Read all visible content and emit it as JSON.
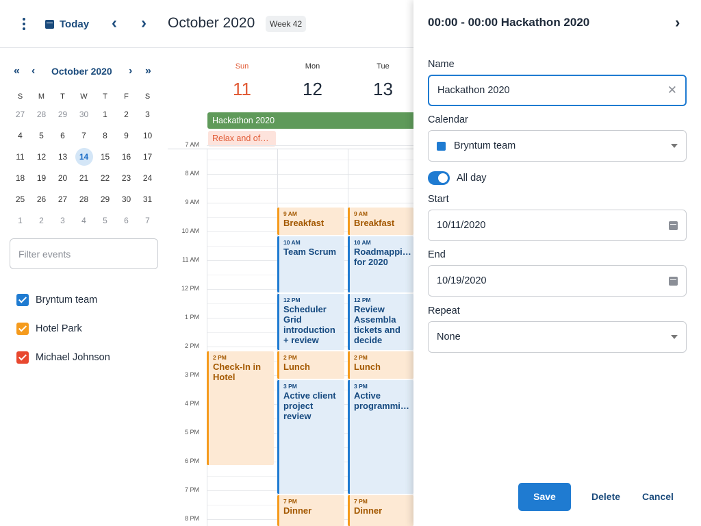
{
  "toolbar": {
    "today_label": "Today",
    "prev": "‹",
    "next": "›",
    "month_title": "October 2020",
    "week_badge": "Week 42"
  },
  "mini_calendar": {
    "title": "October 2020",
    "prev_year": "«",
    "prev_month": "‹",
    "next_month": "›",
    "next_year": "»",
    "weekdays": [
      "S",
      "M",
      "T",
      "W",
      "T",
      "F",
      "S"
    ],
    "weeks": [
      [
        "27",
        "28",
        "29",
        "30",
        "1",
        "2",
        "3"
      ],
      [
        "4",
        "5",
        "6",
        "7",
        "8",
        "9",
        "10"
      ],
      [
        "11",
        "12",
        "13",
        "14",
        "15",
        "16",
        "17"
      ],
      [
        "18",
        "19",
        "20",
        "21",
        "22",
        "23",
        "24"
      ],
      [
        "25",
        "26",
        "27",
        "28",
        "29",
        "30",
        "31"
      ],
      [
        "1",
        "2",
        "3",
        "4",
        "5",
        "6",
        "7"
      ]
    ],
    "today": "14"
  },
  "filter": {
    "placeholder": "Filter events"
  },
  "calendars": [
    {
      "label": "Bryntum team",
      "color": "#1f7bd1"
    },
    {
      "label": "Hotel Park",
      "color": "#f59b1d"
    },
    {
      "label": "Michael Johnson",
      "color": "#e8482f"
    }
  ],
  "week_view": {
    "days": [
      {
        "name": "Sun",
        "date": "11"
      },
      {
        "name": "Mon",
        "date": "12"
      },
      {
        "name": "Tue",
        "date": "13"
      }
    ],
    "allday_event": "Hackathon 2020",
    "allday_sunday_event": "Relax and of…",
    "time_labels": [
      "7 AM",
      "8 AM",
      "9 AM",
      "10 AM",
      "11 AM",
      "12 PM",
      "1 PM",
      "2 PM",
      "3 PM",
      "4 PM",
      "5 PM",
      "6 PM",
      "7 PM",
      "8 PM"
    ],
    "events": {
      "mon_breakfast": {
        "time": "9 AM",
        "name": "Breakfast"
      },
      "mon_scrum": {
        "time": "10 AM",
        "name": "Team Scrum"
      },
      "mon_grid": {
        "time": "12 PM",
        "name": "Scheduler Grid introduction + review"
      },
      "mon_lunch": {
        "time": "2 PM",
        "name": "Lunch"
      },
      "mon_review": {
        "time": "3 PM",
        "name": "Active client project review"
      },
      "mon_dinner": {
        "time": "7 PM",
        "name": "Dinner"
      },
      "tue_breakfast": {
        "time": "9 AM",
        "name": "Breakfast"
      },
      "tue_roadmap": {
        "time": "10 AM",
        "name": "Roadmappi… for 2020"
      },
      "tue_review": {
        "time": "12 PM",
        "name": "Review Assembla tickets and decide"
      },
      "tue_lunch": {
        "time": "2 PM",
        "name": "Lunch"
      },
      "tue_active": {
        "time": "3 PM",
        "name": "Active programmi…"
      },
      "tue_dinner": {
        "time": "7 PM",
        "name": "Dinner"
      },
      "sun_checkin": {
        "time": "2 PM",
        "name": "Check-In in Hotel"
      }
    }
  },
  "editor": {
    "title": "00:00 - 00:00 Hackathon 2020",
    "close": "›",
    "name_label": "Name",
    "name_value": "Hackathon 2020",
    "calendar_label": "Calendar",
    "calendar_value": "Bryntum team",
    "allday_label": "All day",
    "allday_on": true,
    "start_label": "Start",
    "start_value": "10/11/2020",
    "end_label": "End",
    "end_value": "10/19/2020",
    "repeat_label": "Repeat",
    "repeat_value": "None",
    "save_label": "Save",
    "delete_label": "Delete",
    "cancel_label": "Cancel"
  }
}
